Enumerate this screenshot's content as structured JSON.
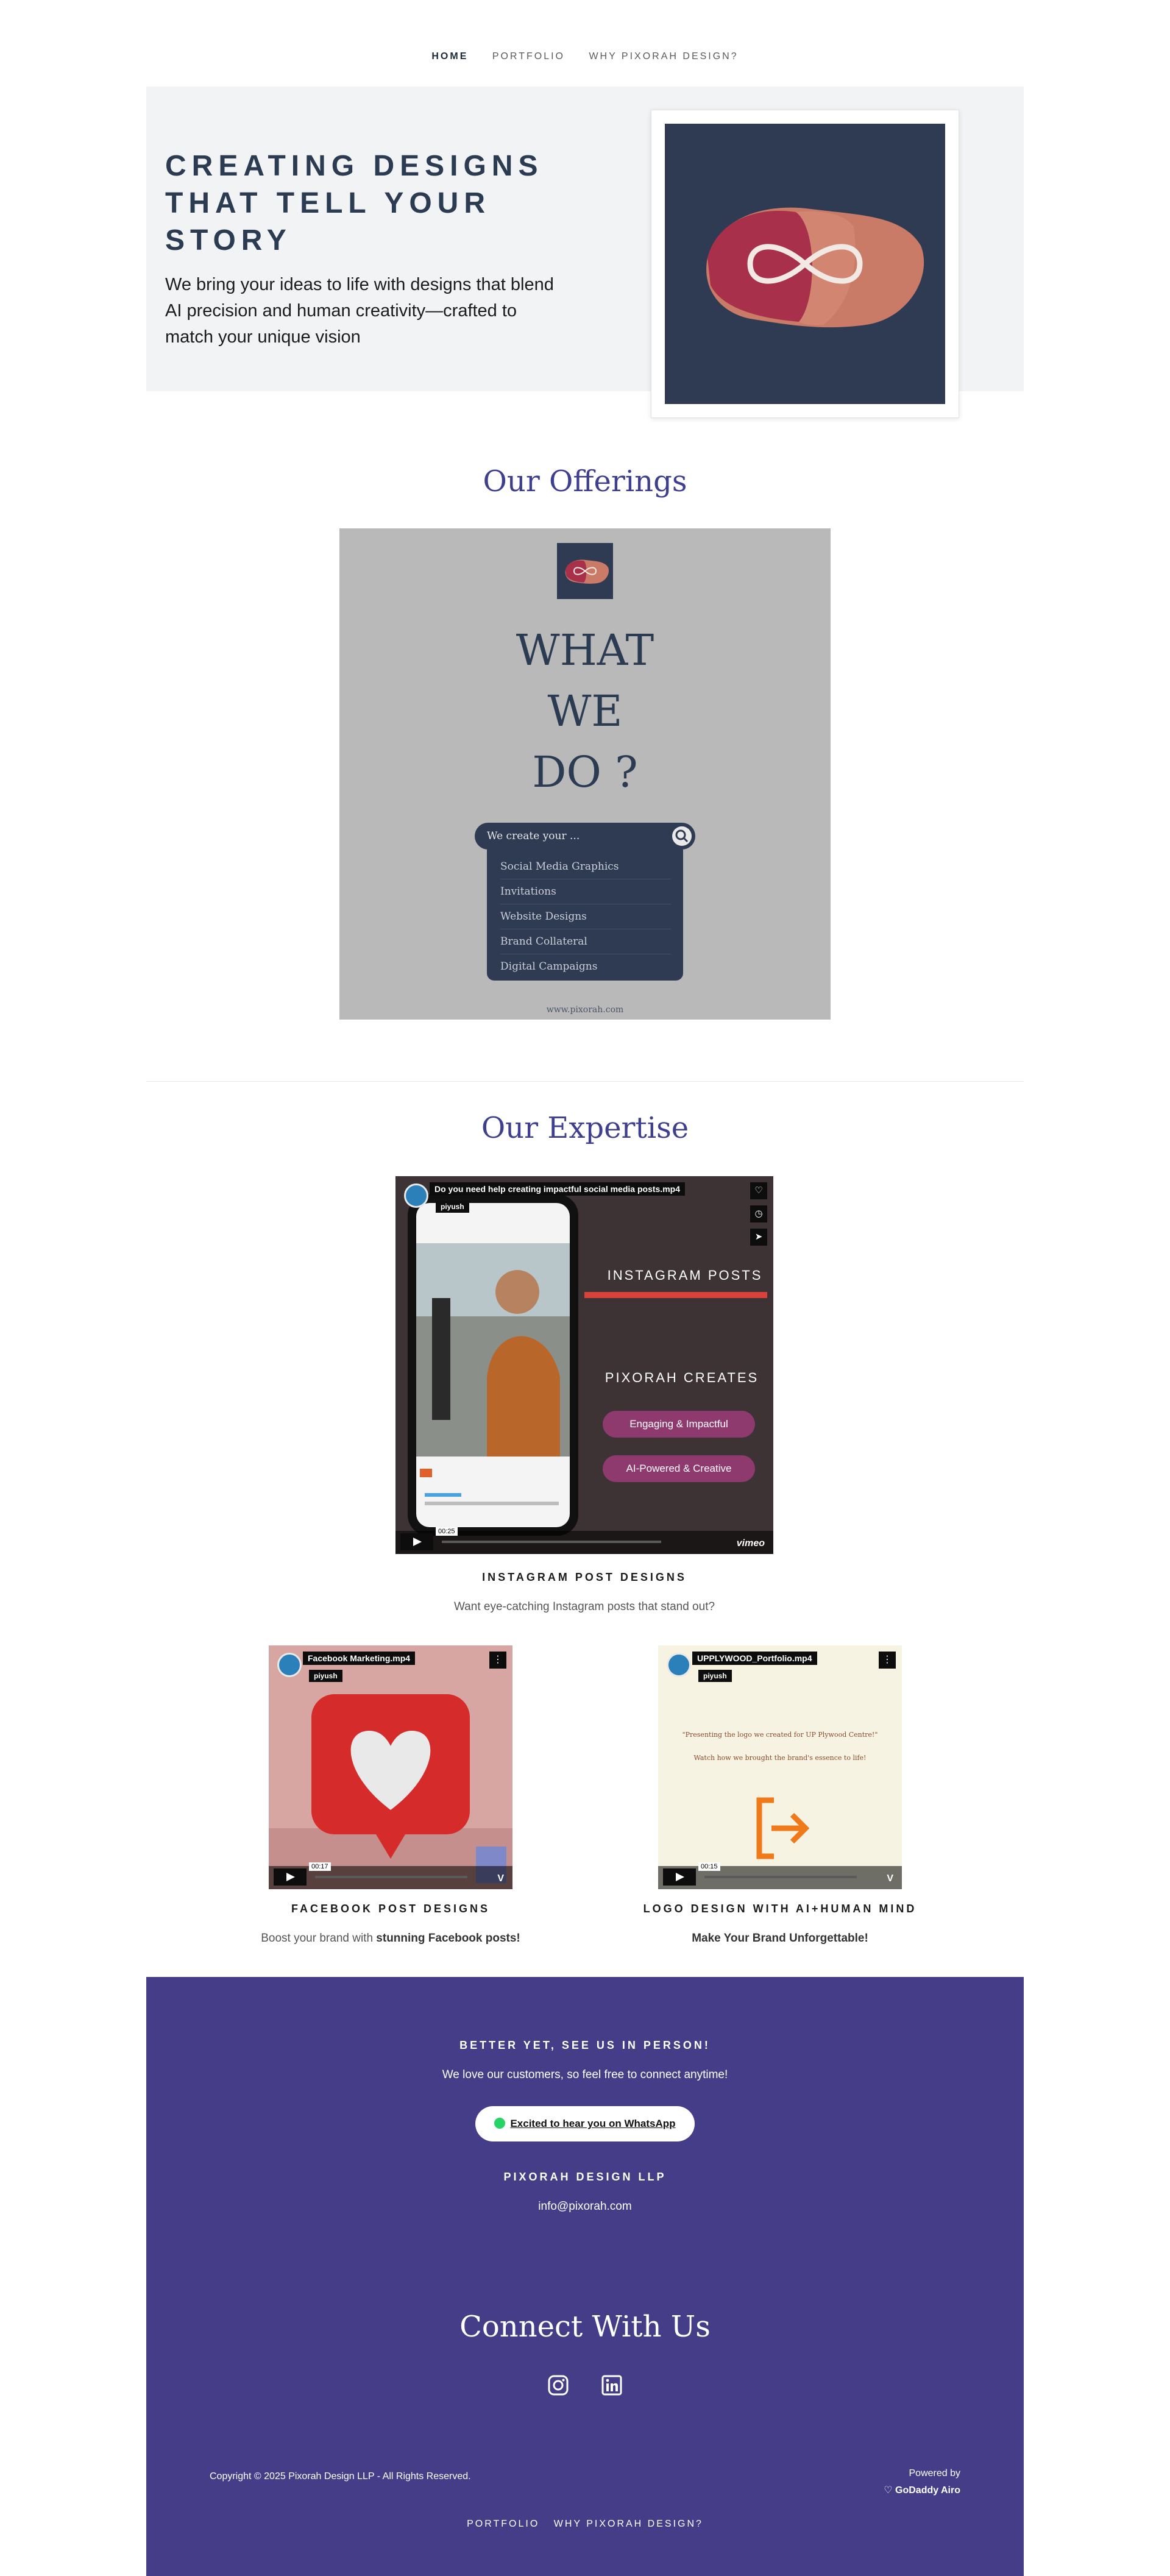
{
  "nav": {
    "items": [
      "HOME",
      "PORTFOLIO",
      "WHY PIXORAH DESIGN?"
    ]
  },
  "hero": {
    "title": "CREATING DESIGNS THAT TELL YOUR STORY",
    "subtitle": "We bring your ideas to life with designs that blend AI precision and human creativity—crafted to match your unique vision"
  },
  "offerings": {
    "title": "Our Offerings",
    "poster": {
      "heading_lines": [
        "WHAT",
        "WE",
        "DO ?"
      ],
      "search_text": "We create your ...",
      "items": [
        "Social Media Graphics",
        "Invitations",
        "Website Designs",
        "Brand Collateral",
        "Digital Campaigns"
      ],
      "url": "www.pixorah.com"
    }
  },
  "expertise": {
    "title": "Our Expertise",
    "videos": [
      {
        "file": "Do you need help creating impactful social media posts.mp4",
        "user": "piyush",
        "overlay": [
          "INSTAGRAM POSTS",
          "PIXORAH CREATES",
          "Engaging & Impactful",
          "AI-Powered & Creative"
        ],
        "time": "00:25",
        "caption": "INSTAGRAM POST DESIGNS",
        "description": "Want eye-catching Instagram posts that stand out?",
        "description_bold": ""
      },
      {
        "file": "Facebook Marketing.mp4",
        "user": "piyush",
        "time": "00:17",
        "caption": "FACEBOOK POST DESIGNS",
        "description": "Boost your brand with ",
        "description_bold": "stunning Facebook posts!"
      },
      {
        "file": "UPPLYWOOD_Portfolio.mp4",
        "user": "piyush",
        "overlay": [
          "\"Presenting the logo we created for UP Plywood Centre!\"",
          "Watch how we brought the brand's essence to life!"
        ],
        "time": "00:15",
        "caption": "LOGO DESIGN WITH AI+HUMAN MIND",
        "description": "",
        "description_bold": "Make Your Brand Unforgettable!"
      }
    ]
  },
  "footer": {
    "heading": "BETTER YET, SEE US IN PERSON!",
    "text": "We love our customers, so feel free to connect anytime!",
    "whatsapp_label": "Excited to hear you on WhatsApp",
    "company": "PIXORAH DESIGN LLP",
    "email": "info@pixorah.com",
    "connect_title": "Connect With Us",
    "social_icons": [
      "instagram-icon",
      "linkedin-icon"
    ],
    "copyright": "Copyright © 2025 Pixorah Design LLP - All Rights Reserved.",
    "powered_by": "Powered by",
    "powered_brand": "GoDaddy Airo",
    "nav": [
      "PORTFOLIO",
      "WHY PIXORAH DESIGN?"
    ]
  },
  "colors": {
    "accent": "#3e3f8f",
    "footer_bg": "#463d88",
    "hero_bg": "#f2f3f4",
    "navy": "#2e3b52"
  }
}
